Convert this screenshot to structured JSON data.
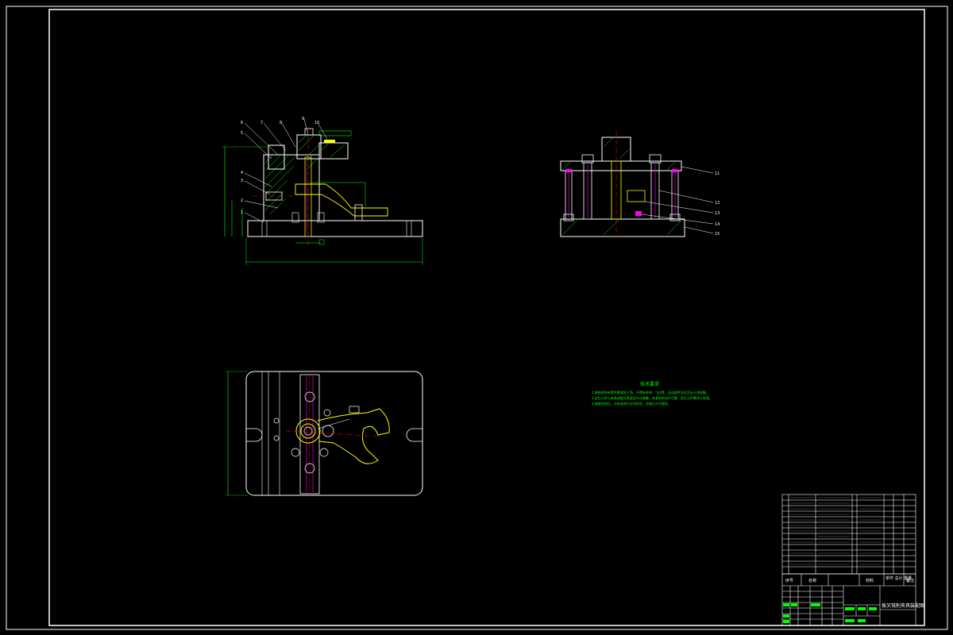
{
  "drawing": {
    "title_block": {
      "drawing_name": "拨叉铣削夹具装配图",
      "header_cells": [
        "序号",
        "名称",
        "材料",
        "单件 总计 重量",
        "备注"
      ]
    },
    "technical_requirements": {
      "title": "技术要求",
      "lines": [
        "1.装配前所有零件需清洗干净，不得有毛刺、飞边等，运动部件应灵活无卡滞现象。",
        "2.定位元件与夹具体配合表面应均匀接触，夹紧机构动作可靠，定位元件需淬火处理。",
        "3.装配完成后，对夹具进行试切检验，合格后方可使用。"
      ]
    },
    "front_view_balloons": [
      "6",
      "7",
      "8",
      "9",
      "10",
      "5",
      "4",
      "3",
      "2",
      "1"
    ],
    "side_view_balloons": [
      "11",
      "12",
      "13",
      "14",
      "15"
    ],
    "colors": {
      "outline": "#ffffff",
      "center_line": "#ff0000",
      "part_yellow": "#ffff00",
      "dimension": "#00ff00",
      "hidden": "#ff00ff",
      "hatch": "#00ff00"
    }
  }
}
